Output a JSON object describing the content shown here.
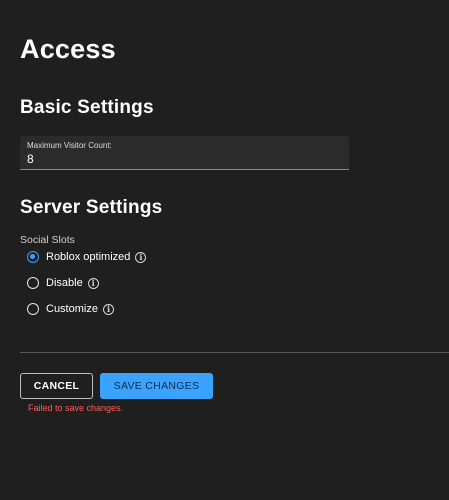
{
  "page": {
    "title": "Access"
  },
  "basic_settings": {
    "title": "Basic Settings",
    "max_visitor_field": {
      "label": "Maximum Visitor Count:",
      "value": "8"
    }
  },
  "server_settings": {
    "title": "Server Settings",
    "social_slots": {
      "label": "Social Slots",
      "options": [
        {
          "label": "Roblox optimized",
          "selected": true,
          "info_icon": "info-icon"
        },
        {
          "label": "Disable",
          "selected": false,
          "info_icon": "info-icon"
        },
        {
          "label": "Customize",
          "selected": false,
          "info_icon": "info-icon"
        }
      ]
    }
  },
  "actions": {
    "cancel_label": "CANCEL",
    "save_label": "SAVE CHANGES",
    "error_message": "Failed to save changes."
  },
  "colors": {
    "background": "#1f1f1f",
    "accent": "#3aa3ff",
    "error": "#ff5a5a"
  }
}
